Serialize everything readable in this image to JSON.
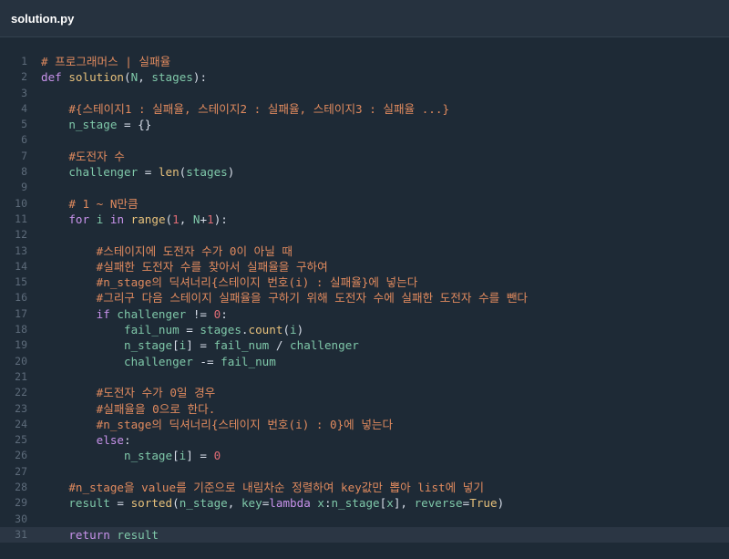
{
  "window": {
    "title": "solution.py"
  },
  "colors": {
    "comment": "#e08a5e",
    "keyword": "#c792ea",
    "function": "#e6c07b",
    "param": "#7fc8a9",
    "number": "#e06c75",
    "plain": "#d8dee9",
    "background": "#1e2a36",
    "gutter": "#5d6b7a"
  },
  "active_line": 31,
  "lines": [
    {
      "n": "1",
      "tokens": [
        [
          "comment",
          "# 프로그래머스 | 실패율"
        ]
      ]
    },
    {
      "n": "2",
      "tokens": [
        [
          "keyword",
          "def "
        ],
        [
          "func",
          "solution"
        ],
        [
          "plain",
          "("
        ],
        [
          "param",
          "N"
        ],
        [
          "plain",
          ", "
        ],
        [
          "param",
          "stages"
        ],
        [
          "plain",
          "):"
        ]
      ]
    },
    {
      "n": "3",
      "tokens": []
    },
    {
      "n": "4",
      "tokens": [
        [
          "plain",
          "    "
        ],
        [
          "comment",
          "#{스테이지1 : 실패율, 스테이지2 : 실패율, 스테이지3 : 실패율 ...}"
        ]
      ]
    },
    {
      "n": "5",
      "tokens": [
        [
          "plain",
          "    "
        ],
        [
          "param",
          "n_stage"
        ],
        [
          "plain",
          " = {}"
        ]
      ]
    },
    {
      "n": "6",
      "tokens": []
    },
    {
      "n": "7",
      "tokens": [
        [
          "plain",
          "    "
        ],
        [
          "comment",
          "#도전자 수"
        ]
      ]
    },
    {
      "n": "8",
      "tokens": [
        [
          "plain",
          "    "
        ],
        [
          "param",
          "challenger"
        ],
        [
          "plain",
          " = "
        ],
        [
          "func",
          "len"
        ],
        [
          "plain",
          "("
        ],
        [
          "param",
          "stages"
        ],
        [
          "plain",
          ")"
        ]
      ]
    },
    {
      "n": "9",
      "tokens": []
    },
    {
      "n": "10",
      "tokens": [
        [
          "plain",
          "    "
        ],
        [
          "comment",
          "# 1 ~ N만큼"
        ]
      ]
    },
    {
      "n": "11",
      "tokens": [
        [
          "plain",
          "    "
        ],
        [
          "keyword",
          "for "
        ],
        [
          "param",
          "i"
        ],
        [
          "keyword",
          " in "
        ],
        [
          "func",
          "range"
        ],
        [
          "plain",
          "("
        ],
        [
          "number",
          "1"
        ],
        [
          "plain",
          ", "
        ],
        [
          "param",
          "N"
        ],
        [
          "plain",
          "+"
        ],
        [
          "number",
          "1"
        ],
        [
          "plain",
          "):"
        ]
      ]
    },
    {
      "n": "12",
      "tokens": []
    },
    {
      "n": "13",
      "tokens": [
        [
          "plain",
          "        "
        ],
        [
          "comment",
          "#스테이지에 도전자 수가 0이 아닐 때"
        ]
      ]
    },
    {
      "n": "14",
      "tokens": [
        [
          "plain",
          "        "
        ],
        [
          "comment",
          "#실패한 도전자 수를 찾아서 실패율을 구하여"
        ]
      ]
    },
    {
      "n": "15",
      "tokens": [
        [
          "plain",
          "        "
        ],
        [
          "comment",
          "#n_stage의 딕셔너리{스테이지 번호(i) : 실패율}에 넣는다"
        ]
      ]
    },
    {
      "n": "16",
      "tokens": [
        [
          "plain",
          "        "
        ],
        [
          "comment",
          "#그리구 다음 스테이지 실패율을 구하기 위해 도전자 수에 실패한 도전자 수를 뺀다"
        ]
      ]
    },
    {
      "n": "17",
      "tokens": [
        [
          "plain",
          "        "
        ],
        [
          "keyword",
          "if "
        ],
        [
          "param",
          "challenger"
        ],
        [
          "plain",
          " != "
        ],
        [
          "number",
          "0"
        ],
        [
          "plain",
          ":"
        ]
      ]
    },
    {
      "n": "18",
      "tokens": [
        [
          "plain",
          "            "
        ],
        [
          "param",
          "fail_num"
        ],
        [
          "plain",
          " = "
        ],
        [
          "param",
          "stages"
        ],
        [
          "plain",
          "."
        ],
        [
          "func",
          "count"
        ],
        [
          "plain",
          "("
        ],
        [
          "param",
          "i"
        ],
        [
          "plain",
          ")"
        ]
      ]
    },
    {
      "n": "19",
      "tokens": [
        [
          "plain",
          "            "
        ],
        [
          "param",
          "n_stage"
        ],
        [
          "plain",
          "["
        ],
        [
          "param",
          "i"
        ],
        [
          "plain",
          "] = "
        ],
        [
          "param",
          "fail_num"
        ],
        [
          "plain",
          " / "
        ],
        [
          "param",
          "challenger"
        ]
      ]
    },
    {
      "n": "20",
      "tokens": [
        [
          "plain",
          "            "
        ],
        [
          "param",
          "challenger"
        ],
        [
          "plain",
          " -= "
        ],
        [
          "param",
          "fail_num"
        ]
      ]
    },
    {
      "n": "21",
      "tokens": []
    },
    {
      "n": "22",
      "tokens": [
        [
          "plain",
          "        "
        ],
        [
          "comment",
          "#도전자 수가 0일 경우"
        ]
      ]
    },
    {
      "n": "23",
      "tokens": [
        [
          "plain",
          "        "
        ],
        [
          "comment",
          "#실패율을 0으로 한다."
        ]
      ]
    },
    {
      "n": "24",
      "tokens": [
        [
          "plain",
          "        "
        ],
        [
          "comment",
          "#n_stage의 딕셔너리{스테이지 번호(i) : 0}에 넣는다"
        ]
      ]
    },
    {
      "n": "25",
      "tokens": [
        [
          "plain",
          "        "
        ],
        [
          "keyword",
          "else"
        ],
        [
          "plain",
          ":"
        ]
      ]
    },
    {
      "n": "26",
      "tokens": [
        [
          "plain",
          "            "
        ],
        [
          "param",
          "n_stage"
        ],
        [
          "plain",
          "["
        ],
        [
          "param",
          "i"
        ],
        [
          "plain",
          "] = "
        ],
        [
          "number",
          "0"
        ]
      ]
    },
    {
      "n": "27",
      "tokens": []
    },
    {
      "n": "28",
      "tokens": [
        [
          "plain",
          "    "
        ],
        [
          "comment",
          "#n_stage을 value를 기준으로 내림차순 정렬하여 key값만 뽑아 list에 넣기"
        ]
      ]
    },
    {
      "n": "29",
      "tokens": [
        [
          "plain",
          "    "
        ],
        [
          "param",
          "result"
        ],
        [
          "plain",
          " = "
        ],
        [
          "func",
          "sorted"
        ],
        [
          "plain",
          "("
        ],
        [
          "param",
          "n_stage"
        ],
        [
          "plain",
          ", "
        ],
        [
          "param",
          "key"
        ],
        [
          "plain",
          "="
        ],
        [
          "keyword",
          "lambda "
        ],
        [
          "param",
          "x"
        ],
        [
          "plain",
          ":"
        ],
        [
          "param",
          "n_stage"
        ],
        [
          "plain",
          "["
        ],
        [
          "param",
          "x"
        ],
        [
          "plain",
          "], "
        ],
        [
          "param",
          "reverse"
        ],
        [
          "plain",
          "="
        ],
        [
          "func",
          "True"
        ],
        [
          "plain",
          ")"
        ]
      ]
    },
    {
      "n": "30",
      "tokens": []
    },
    {
      "n": "31",
      "tokens": [
        [
          "plain",
          "    "
        ],
        [
          "keyword",
          "return "
        ],
        [
          "param",
          "result"
        ]
      ]
    }
  ]
}
